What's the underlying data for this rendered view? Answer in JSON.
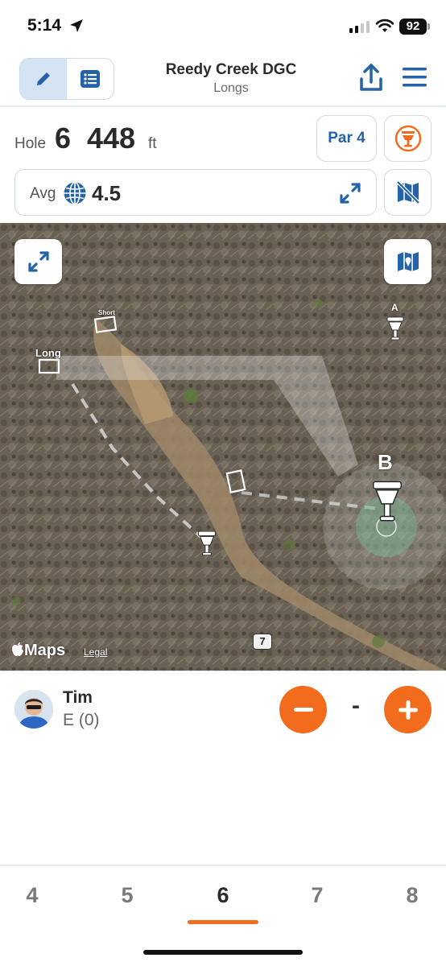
{
  "status_bar": {
    "time": "5:14",
    "battery": "92"
  },
  "header": {
    "title": "Reedy Creek DGC",
    "subtitle": "Longs",
    "mode_tabs": [
      {
        "icon": "pencil-icon",
        "active": true
      },
      {
        "icon": "list-icon",
        "active": false
      }
    ]
  },
  "hole_info": {
    "label": "Hole",
    "number": "6",
    "distance": "448",
    "unit": "ft",
    "par": "Par 4"
  },
  "average": {
    "label": "Avg",
    "value": "4.5"
  },
  "map": {
    "tees": [
      {
        "label": "Short"
      },
      {
        "label": "Long"
      }
    ],
    "baskets": [
      {
        "label": "A"
      },
      {
        "label": "B"
      }
    ],
    "next_hole_marker": "7",
    "attribution": "Maps",
    "legal": "Legal"
  },
  "player": {
    "name": "Tim",
    "score": "E (0)",
    "strokes": "-"
  },
  "hole_nav": [
    {
      "number": "4",
      "current": false
    },
    {
      "number": "5",
      "current": false
    },
    {
      "number": "6",
      "current": true
    },
    {
      "number": "7",
      "current": false
    },
    {
      "number": "8",
      "current": false
    }
  ],
  "colors": {
    "accent_orange": "#f36b1c",
    "accent_blue": "#2563a8",
    "border": "#cfdbe7",
    "active_tab_bg": "#d5e4f4"
  }
}
